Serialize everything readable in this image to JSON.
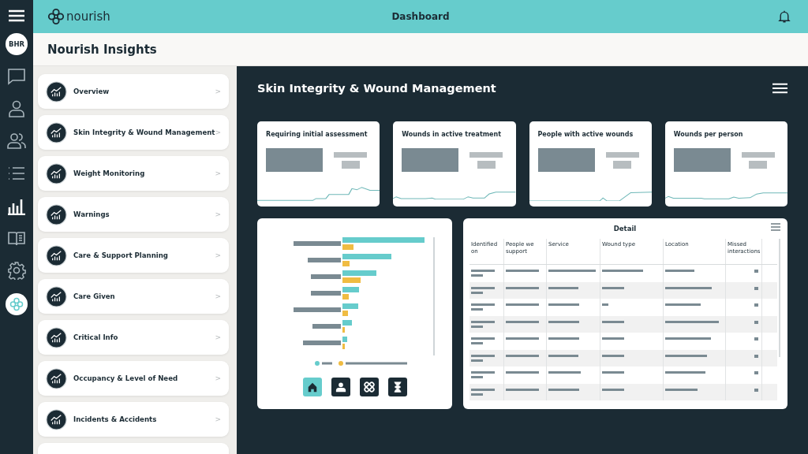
{
  "top_bar": {
    "logo_text": "nourish",
    "title": "Dashboard"
  },
  "rail": {
    "avatar": "BHR",
    "items": [
      {
        "kind": "chat",
        "selected": false
      },
      {
        "kind": "person",
        "selected": false
      },
      {
        "kind": "people",
        "selected": false
      },
      {
        "kind": "list",
        "selected": false
      },
      {
        "kind": "chart",
        "selected": true
      },
      {
        "kind": "book",
        "selected": false
      },
      {
        "kind": "gear",
        "selected": false
      },
      {
        "kind": "logo",
        "selected": false
      }
    ]
  },
  "page_title": "Nourish Insights",
  "insights": [
    {
      "label": "Overview",
      "chevron": ">"
    },
    {
      "label": "Skin Integrity & Wound Management",
      "chevron": ">"
    },
    {
      "label": "Weight Monitoring",
      "chevron": ">"
    },
    {
      "label": "Warnings",
      "chevron": ">"
    },
    {
      "label": "Care & Support Planning",
      "chevron": ">"
    },
    {
      "label": "Care Given",
      "chevron": ">"
    },
    {
      "label": "Critical Info",
      "chevron": ">"
    },
    {
      "label": "Occupancy & Level of Need",
      "chevron": ">"
    },
    {
      "label": "Incidents & Accidents",
      "chevron": ">"
    }
  ],
  "dashboard": {
    "title": "Skin Integrity & Wound Management",
    "kpis": [
      {
        "title": "Requiring initial assessment"
      },
      {
        "title": "Wounds in active treatment"
      },
      {
        "title": "People with active wounds"
      },
      {
        "title": "Wounds per person"
      }
    ],
    "chart_tabs": [
      {
        "kind": "home",
        "selected": true
      },
      {
        "kind": "person",
        "selected": false
      },
      {
        "kind": "bandage",
        "selected": false
      },
      {
        "kind": "hourglass",
        "selected": false
      }
    ],
    "detail": {
      "title": "Detail",
      "columns": [
        "Identified on",
        "People we support",
        "Service",
        "Wound type",
        "Location",
        "Missed interactions"
      ]
    }
  }
}
